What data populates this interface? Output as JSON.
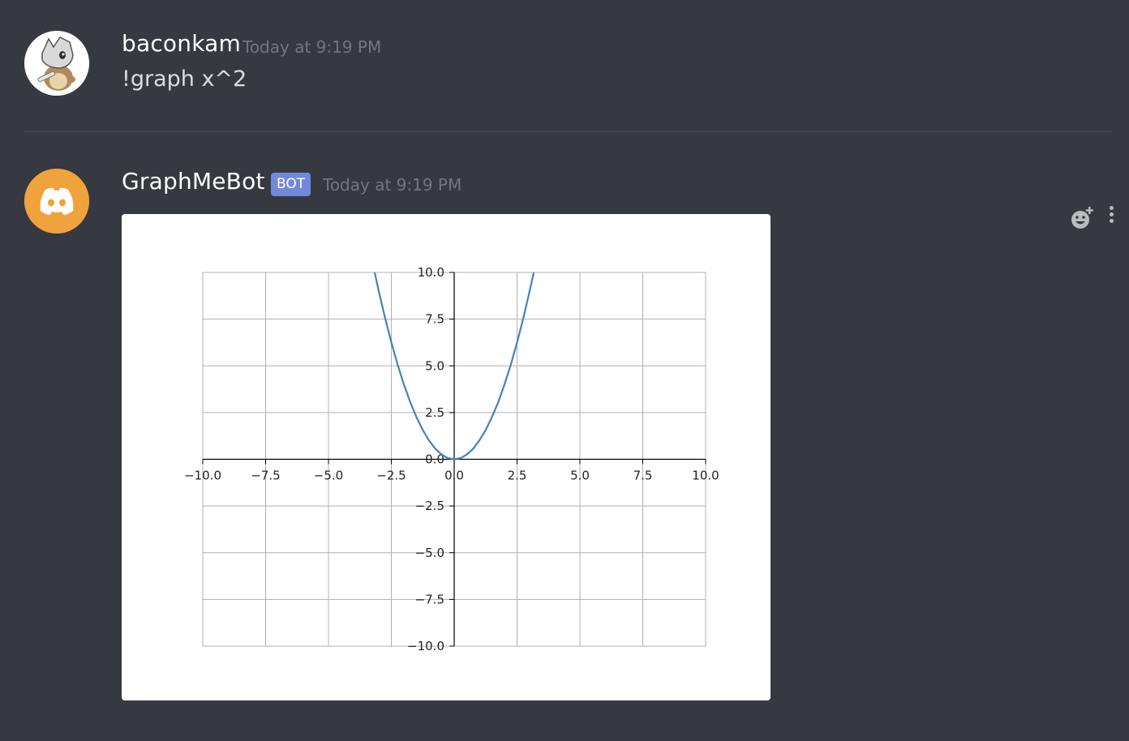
{
  "messages": [
    {
      "username": "baconkam",
      "timestamp": "Today at 9:19 PM",
      "content": "!graph x^2",
      "avatar_icon": "cubone-avatar"
    },
    {
      "username": "GraphMeBot",
      "badge": "BOT",
      "timestamp": "Today at 9:19 PM",
      "avatar_icon": "discord-logo-icon",
      "avatar_color": "#f0a33c"
    }
  ],
  "actions": {
    "add_reaction_icon": "add-reaction-icon",
    "more_icon": "more-options-icon"
  },
  "chart_data": {
    "type": "line",
    "function": "x^2",
    "xlim": [
      -10,
      10
    ],
    "ylim": [
      -10,
      10
    ],
    "x_ticks": [
      "−10.0",
      "−7.5",
      "−5.0",
      "−2.5",
      "0.0",
      "2.5",
      "5.0",
      "7.5",
      "10.0"
    ],
    "y_ticks": [
      "10.0",
      "7.5",
      "5.0",
      "2.5",
      "0.0",
      "−2.5",
      "−5.0",
      "−7.5",
      "−10.0"
    ],
    "tick_values": [
      -10,
      -7.5,
      -5,
      -2.5,
      0,
      2.5,
      5,
      7.5,
      10
    ],
    "grid": true,
    "series_color": "#4682b4",
    "series": [
      {
        "x": [
          -3.16,
          -3,
          -2.75,
          -2.5,
          -2.25,
          -2,
          -1.75,
          -1.5,
          -1.25,
          -1,
          -0.75,
          -0.5,
          -0.25,
          0,
          0.25,
          0.5,
          0.75,
          1,
          1.25,
          1.5,
          1.75,
          2,
          2.25,
          2.5,
          2.75,
          3,
          3.16
        ],
        "y": [
          9.99,
          9,
          7.56,
          6.25,
          5.06,
          4,
          3.06,
          2.25,
          1.56,
          1,
          0.56,
          0.25,
          0.06,
          0,
          0.06,
          0.25,
          0.56,
          1,
          1.56,
          2.25,
          3.06,
          4,
          5.06,
          6.25,
          7.56,
          9,
          9.99
        ]
      }
    ]
  }
}
